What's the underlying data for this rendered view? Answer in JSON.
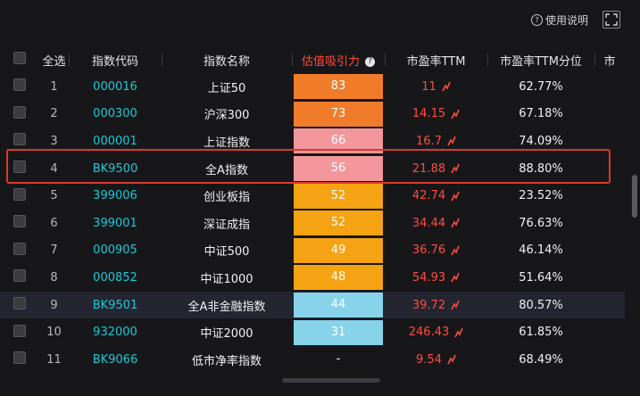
{
  "topbar": {
    "help_label": "使用说明",
    "help_icon": "question-circle-icon",
    "fullscreen_icon": "fullscreen-icon"
  },
  "table": {
    "headers": {
      "select_all": "全选",
      "code": "指数代码",
      "name": "指数名称",
      "valuation": "估值吸引力",
      "pe": "市盈率TTM",
      "pe_pct": "市盈率TTM分位",
      "extra": "市"
    },
    "rows": [
      {
        "idx": "1",
        "code": "000016",
        "name": "上证50",
        "score": "83",
        "pe": "11",
        "pct": "62.77%",
        "color": "#f07c2a"
      },
      {
        "idx": "2",
        "code": "000300",
        "name": "沪深300",
        "score": "73",
        "pe": "14.15",
        "pct": "67.18%",
        "color": "#f07c2a"
      },
      {
        "idx": "3",
        "code": "000001",
        "name": "上证指数",
        "score": "66",
        "pe": "16.7",
        "pct": "74.09%",
        "color": "#f3979c"
      },
      {
        "idx": "4",
        "code": "BK9500",
        "name": "全A指数",
        "score": "56",
        "pe": "21.88",
        "pct": "88.80%",
        "color": "#f3979c"
      },
      {
        "idx": "5",
        "code": "399006",
        "name": "创业板指",
        "score": "52",
        "pe": "42.74",
        "pct": "23.52%",
        "color": "#f5a312"
      },
      {
        "idx": "6",
        "code": "399001",
        "name": "深证成指",
        "score": "52",
        "pe": "34.44",
        "pct": "76.63%",
        "color": "#f5a312"
      },
      {
        "idx": "7",
        "code": "000905",
        "name": "中证500",
        "score": "49",
        "pe": "36.76",
        "pct": "46.14%",
        "color": "#f5a312"
      },
      {
        "idx": "8",
        "code": "000852",
        "name": "中证1000",
        "score": "48",
        "pe": "54.93",
        "pct": "51.64%",
        "color": "#f5a312"
      },
      {
        "idx": "9",
        "code": "BK9501",
        "name": "全A非金融指数",
        "score": "44",
        "pe": "39.72",
        "pct": "80.57%",
        "color": "#86d3ea"
      },
      {
        "idx": "10",
        "code": "932000",
        "name": "中证2000",
        "score": "31",
        "pe": "246.43",
        "pct": "61.85%",
        "color": "#86d3ea"
      },
      {
        "idx": "11",
        "code": "BK9066",
        "name": "低市净率指数",
        "score": "-",
        "pe": "9.54",
        "pct": "68.49%",
        "color": ""
      }
    ]
  },
  "colors": {
    "highlight_frame": "#d93a2c",
    "pe_text": "#ff4d3d",
    "code_text": "#1ec8d6"
  }
}
